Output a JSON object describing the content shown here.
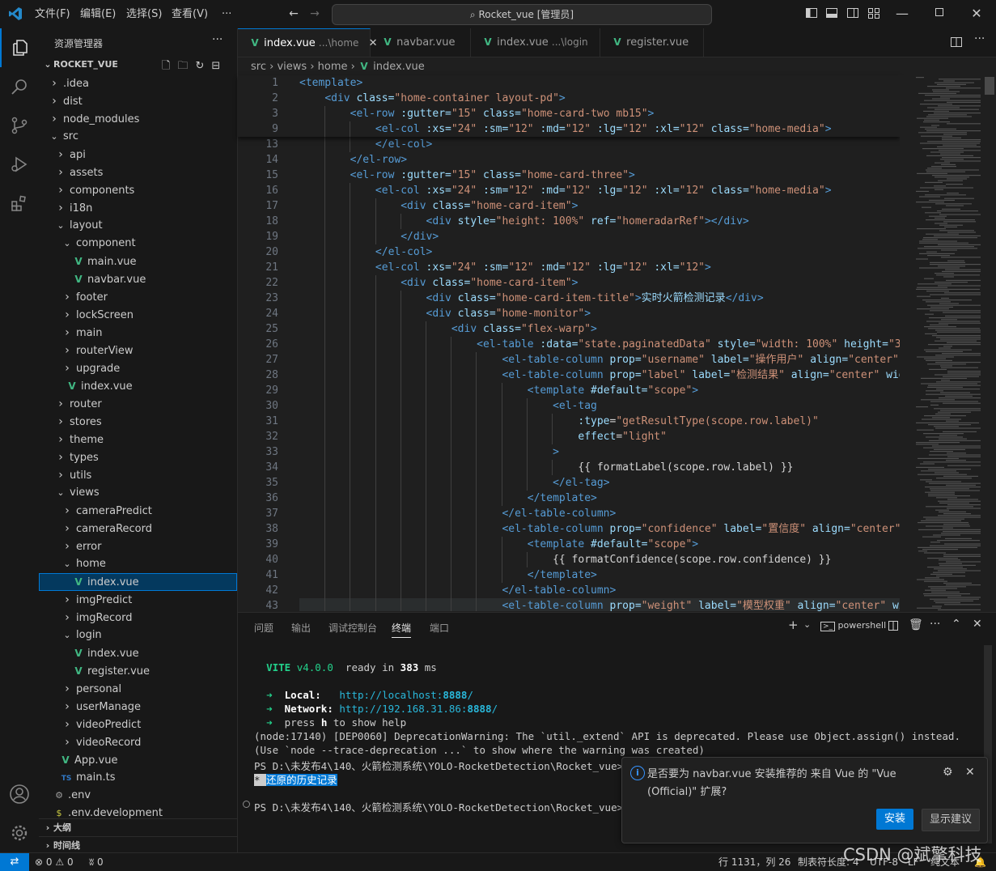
{
  "titlebar": {
    "menus": [
      "文件(F)",
      "编辑(E)",
      "选择(S)",
      "查看(V)",
      "···"
    ],
    "search": "Rocket_vue [管理员]"
  },
  "sidebar": {
    "header": "资源管理器",
    "more": "···",
    "root": "ROCKET_VUE",
    "items": [
      {
        "label": ".idea",
        "icon": "chevron-right",
        "level": 1
      },
      {
        "label": "dist",
        "icon": "chevron-right",
        "level": 1
      },
      {
        "label": "node_modules",
        "icon": "chevron-right",
        "level": 1
      },
      {
        "label": "src",
        "icon": "chevron-down",
        "level": 1
      },
      {
        "label": "api",
        "icon": "chevron-right",
        "level": 2
      },
      {
        "label": "assets",
        "icon": "chevron-right",
        "level": 2
      },
      {
        "label": "components",
        "icon": "chevron-right",
        "level": 2
      },
      {
        "label": "i18n",
        "icon": "chevron-right",
        "level": 2
      },
      {
        "label": "layout",
        "icon": "chevron-down",
        "level": 2
      },
      {
        "label": "component",
        "icon": "chevron-down",
        "level": 3
      },
      {
        "label": "main.vue",
        "icon": "vue",
        "level": 4
      },
      {
        "label": "navbar.vue",
        "icon": "vue",
        "level": 4
      },
      {
        "label": "footer",
        "icon": "chevron-right",
        "level": 3
      },
      {
        "label": "lockScreen",
        "icon": "chevron-right",
        "level": 3
      },
      {
        "label": "main",
        "icon": "chevron-right",
        "level": 3
      },
      {
        "label": "routerView",
        "icon": "chevron-right",
        "level": 3
      },
      {
        "label": "upgrade",
        "icon": "chevron-right",
        "level": 3
      },
      {
        "label": "index.vue",
        "icon": "vue",
        "level": 3
      },
      {
        "label": "router",
        "icon": "chevron-right",
        "level": 2
      },
      {
        "label": "stores",
        "icon": "chevron-right",
        "level": 2
      },
      {
        "label": "theme",
        "icon": "chevron-right",
        "level": 2
      },
      {
        "label": "types",
        "icon": "chevron-right",
        "level": 2
      },
      {
        "label": "utils",
        "icon": "chevron-right",
        "level": 2
      },
      {
        "label": "views",
        "icon": "chevron-down",
        "level": 2
      },
      {
        "label": "cameraPredict",
        "icon": "chevron-right",
        "level": 3
      },
      {
        "label": "cameraRecord",
        "icon": "chevron-right",
        "level": 3
      },
      {
        "label": "error",
        "icon": "chevron-right",
        "level": 3
      },
      {
        "label": "home",
        "icon": "chevron-down",
        "level": 3
      },
      {
        "label": "index.vue",
        "icon": "vue",
        "level": 4,
        "selected": true
      },
      {
        "label": "imgPredict",
        "icon": "chevron-right",
        "level": 3
      },
      {
        "label": "imgRecord",
        "icon": "chevron-right",
        "level": 3
      },
      {
        "label": "login",
        "icon": "chevron-down",
        "level": 3
      },
      {
        "label": "index.vue",
        "icon": "vue",
        "level": 4
      },
      {
        "label": "register.vue",
        "icon": "vue",
        "level": 4
      },
      {
        "label": "personal",
        "icon": "chevron-right",
        "level": 3
      },
      {
        "label": "userManage",
        "icon": "chevron-right",
        "level": 3
      },
      {
        "label": "videoPredict",
        "icon": "chevron-right",
        "level": 3
      },
      {
        "label": "videoRecord",
        "icon": "chevron-right",
        "level": 3
      },
      {
        "label": "App.vue",
        "icon": "vue",
        "level": 2
      },
      {
        "label": "main.ts",
        "icon": "ts",
        "level": 2
      },
      {
        "label": ".env",
        "icon": "gear",
        "level": 1
      },
      {
        "label": ".env.development",
        "icon": "dollar",
        "level": 1
      }
    ],
    "outline": "大纲",
    "timeline": "时间线"
  },
  "tabs": [
    {
      "name": "index.vue",
      "desc": "...\\home",
      "active": true
    },
    {
      "name": "navbar.vue",
      "desc": ""
    },
    {
      "name": "index.vue",
      "desc": "...\\login"
    },
    {
      "name": "register.vue",
      "desc": ""
    }
  ],
  "breadcrumb": [
    "src",
    "views",
    "home",
    "index.vue"
  ],
  "editor": {
    "sticky_lines": [
      {
        "n": "1",
        "code": "<template>"
      },
      {
        "n": "2",
        "code": "    <div class=\"home-container layout-pd\">"
      },
      {
        "n": "3",
        "code": "        <el-row :gutter=\"15\" class=\"home-card-two mb15\">"
      },
      {
        "n": "9",
        "code": "            <el-col :xs=\"24\" :sm=\"12\" :md=\"12\" :lg=\"12\" :xl=\"12\" class=\"home-media\">"
      }
    ],
    "lines": [
      {
        "n": "13",
        "code": "            </el-col>"
      },
      {
        "n": "14",
        "code": "        </el-row>"
      },
      {
        "n": "15",
        "code": "        <el-row :gutter=\"15\" class=\"home-card-three\">"
      },
      {
        "n": "16",
        "code": "            <el-col :xs=\"24\" :sm=\"12\" :md=\"12\" :lg=\"12\" :xl=\"12\" class=\"home-media\">"
      },
      {
        "n": "17",
        "code": "                <div class=\"home-card-item\">"
      },
      {
        "n": "18",
        "code": "                    <div style=\"height: 100%\" ref=\"homeradarRef\"></div>"
      },
      {
        "n": "19",
        "code": "                </div>"
      },
      {
        "n": "20",
        "code": "            </el-col>"
      },
      {
        "n": "21",
        "code": "            <el-col :xs=\"24\" :sm=\"12\" :md=\"12\" :lg=\"12\" :xl=\"12\">"
      },
      {
        "n": "22",
        "code": "                <div class=\"home-card-item\">"
      },
      {
        "n": "23",
        "code": "                    <div class=\"home-card-item-title\">实时火箭检测记录</div>"
      },
      {
        "n": "24",
        "code": "                    <div class=\"home-monitor\">"
      },
      {
        "n": "25",
        "code": "                        <div class=\"flex-warp\">"
      },
      {
        "n": "26",
        "code": "                            <el-table :data=\"state.paginatedData\" style=\"width: 100%\" height=\"360"
      },
      {
        "n": "27",
        "code": "                                <el-table-column prop=\"username\" label=\"操作用户\" align=\"center\" w"
      },
      {
        "n": "28",
        "code": "                                <el-table-column prop=\"label\" label=\"检测结果\" align=\"center\" wid"
      },
      {
        "n": "29",
        "code": "                                    <template #default=\"scope\">"
      },
      {
        "n": "30",
        "code": "                                        <el-tag"
      },
      {
        "n": "31",
        "code": "                                            :type=\"getResultType(scope.row.label)\""
      },
      {
        "n": "32",
        "code": "                                            effect=\"light\""
      },
      {
        "n": "33",
        "code": "                                        >"
      },
      {
        "n": "34",
        "code": "                                            {{ formatLabel(scope.row.label) }}"
      },
      {
        "n": "35",
        "code": "                                        </el-tag>"
      },
      {
        "n": "36",
        "code": "                                    </template>"
      },
      {
        "n": "37",
        "code": "                                </el-table-column>"
      },
      {
        "n": "38",
        "code": "                                <el-table-column prop=\"confidence\" label=\"置信度\" align=\"center\""
      },
      {
        "n": "39",
        "code": "                                    <template #default=\"scope\">"
      },
      {
        "n": "40",
        "code": "                                        {{ formatConfidence(scope.row.confidence) }}"
      },
      {
        "n": "41",
        "code": "                                    </template>"
      },
      {
        "n": "42",
        "code": "                                </el-table-column>"
      },
      {
        "n": "43",
        "code": "                                <el-table-column prop=\"weight\" label=\"模型权重\" align=\"center\" wi"
      }
    ]
  },
  "panel": {
    "tabs": [
      "问题",
      "输出",
      "调试控制台",
      "终端",
      "端口"
    ],
    "active_tab": "终端",
    "shell": "powershell",
    "terminal": {
      "vite": "VITE",
      "vite_version": "v4.0.0",
      "ready": "ready in",
      "ready_ms": "383",
      "ms": "ms",
      "local_label": "Local:",
      "local_url_a": "http://localhost:",
      "local_port": "8888",
      "local_url_b": "/",
      "network_label": "Network:",
      "network_url_a": "http://192.168.31.86:",
      "network_port": "8888",
      "network_url_b": "/",
      "press_a": "press",
      "press_h": "h",
      "press_b": "to show help",
      "warn1": "(node:17140) [DEP0060] DeprecationWarning: The `util._extend` API is deprecated. Please use Object.assign() instead.",
      "warn2": "(Use `node --trace-deprecation ...` to show where the warning was created)",
      "ps1": "PS D:\\未发布4\\140、火箭检测系统\\YOLO-RocketDetection\\Rocket_vue>",
      "history_star": "*",
      "history": "还原的历史记录",
      "ps2": "PS D:\\未发布4\\140、火箭检测系统\\YOLO-RocketDetection\\Rocket_vue>"
    }
  },
  "notification": {
    "message": "是否要为 navbar.vue 安装推荐的 来自 Vue 的 \"Vue (Official)\" 扩展?",
    "install": "安装",
    "show": "显示建议"
  },
  "statusbar": {
    "errors": "0",
    "warnings": "0",
    "ports": "0",
    "position": "行 1131，列 26",
    "tabsize": "制表符长度: 4",
    "encoding": "UTF-8",
    "eol": "LF",
    "mode": "纯文本",
    "watermark": "CSDN @斌擎科技"
  },
  "colors": {
    "accent": "#0078d4",
    "vue": "#41b883",
    "tag": "#569cd6",
    "attr": "#9cdcfe",
    "string": "#ce9178"
  }
}
